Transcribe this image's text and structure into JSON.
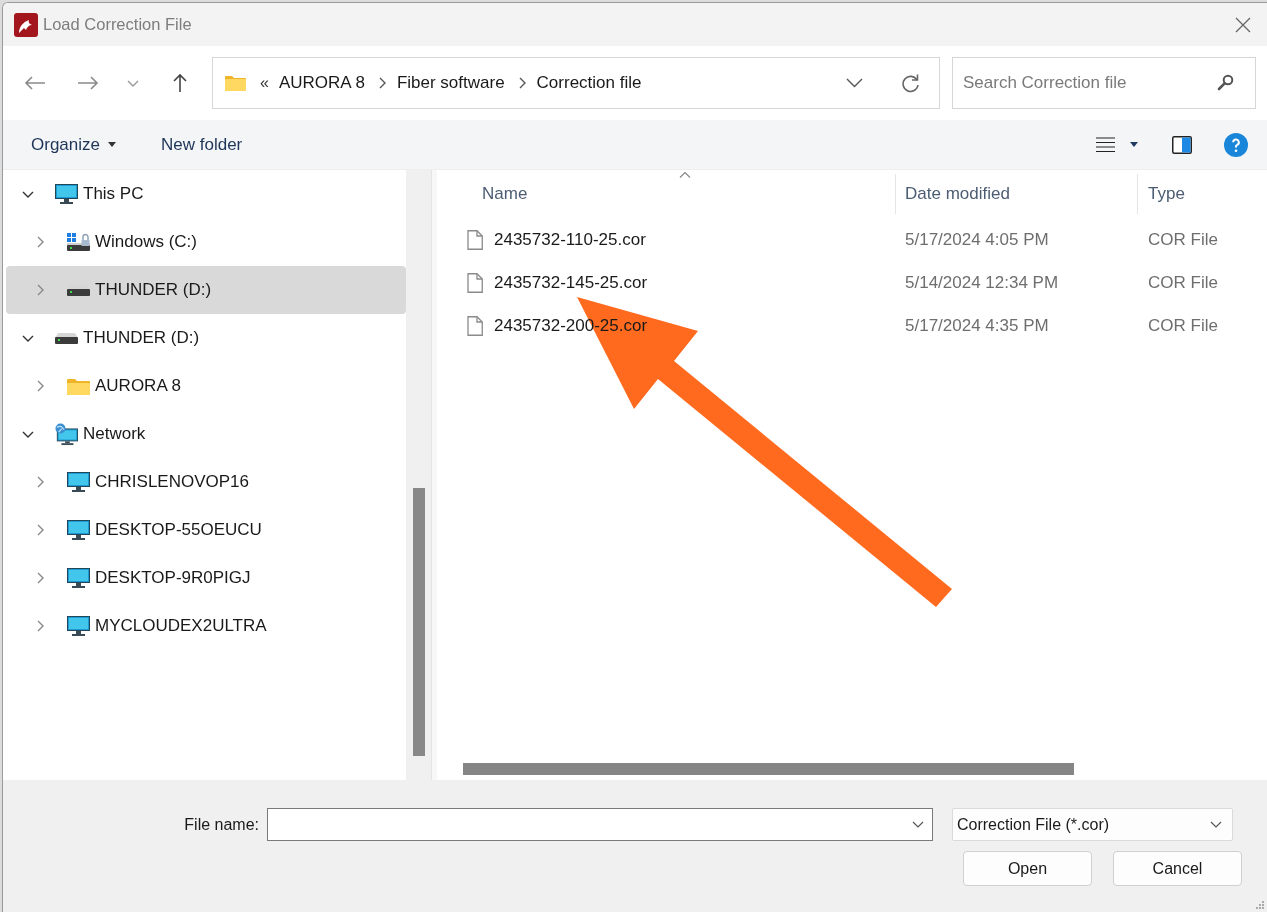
{
  "window": {
    "title": "Load Correction File"
  },
  "address_bar": {
    "overflow": "«",
    "path": [
      "AURORA 8",
      "Fiber software",
      "Correction file"
    ]
  },
  "search": {
    "placeholder": "Search Correction file"
  },
  "toolbar": {
    "organize": "Organize",
    "new_folder": "New folder"
  },
  "sidebar": {
    "items": [
      {
        "label": "This PC",
        "kind": "pc",
        "expanded": true,
        "selected": false,
        "children": [
          {
            "label": "Windows (C:)",
            "kind": "system_drive",
            "expanded": false,
            "selected": false
          },
          {
            "label": "THUNDER (D:)",
            "kind": "drive",
            "expanded": false,
            "selected": true
          }
        ]
      },
      {
        "label": "THUNDER (D:)",
        "kind": "drive",
        "expanded": true,
        "selected": false,
        "children": [
          {
            "label": "AURORA 8",
            "kind": "folder",
            "expanded": false,
            "selected": false
          }
        ]
      },
      {
        "label": "Network",
        "kind": "network",
        "expanded": true,
        "selected": false,
        "children": [
          {
            "label": "CHRISLENOVOP16",
            "kind": "computer",
            "expanded": false,
            "selected": false
          },
          {
            "label": "DESKTOP-55OEUCU",
            "kind": "computer",
            "expanded": false,
            "selected": false
          },
          {
            "label": "DESKTOP-9R0PIGJ",
            "kind": "computer",
            "expanded": false,
            "selected": false
          },
          {
            "label": "MYCLOUDEX2ULTRA",
            "kind": "computer",
            "expanded": false,
            "selected": false
          }
        ]
      }
    ]
  },
  "file_list": {
    "columns": [
      {
        "label": "Name",
        "sorted": true
      },
      {
        "label": "Date modified",
        "sorted": false
      },
      {
        "label": "Type",
        "sorted": false
      }
    ],
    "rows": [
      {
        "name": "2435732-110-25.cor",
        "date_modified": "5/17/2024 4:05 PM",
        "type": "COR File",
        "selected": false
      },
      {
        "name": "2435732-145-25.cor",
        "date_modified": "5/14/2024 12:34 PM",
        "type": "COR File",
        "selected": false
      },
      {
        "name": "2435732-200-25.cor",
        "date_modified": "5/17/2024 4:35 PM",
        "type": "COR File",
        "selected": false
      }
    ]
  },
  "file_name": {
    "label": "File name:"
  },
  "file_type": {
    "value": "Correction File (*.cor)"
  },
  "buttons": [
    "Open",
    "Cancel"
  ]
}
